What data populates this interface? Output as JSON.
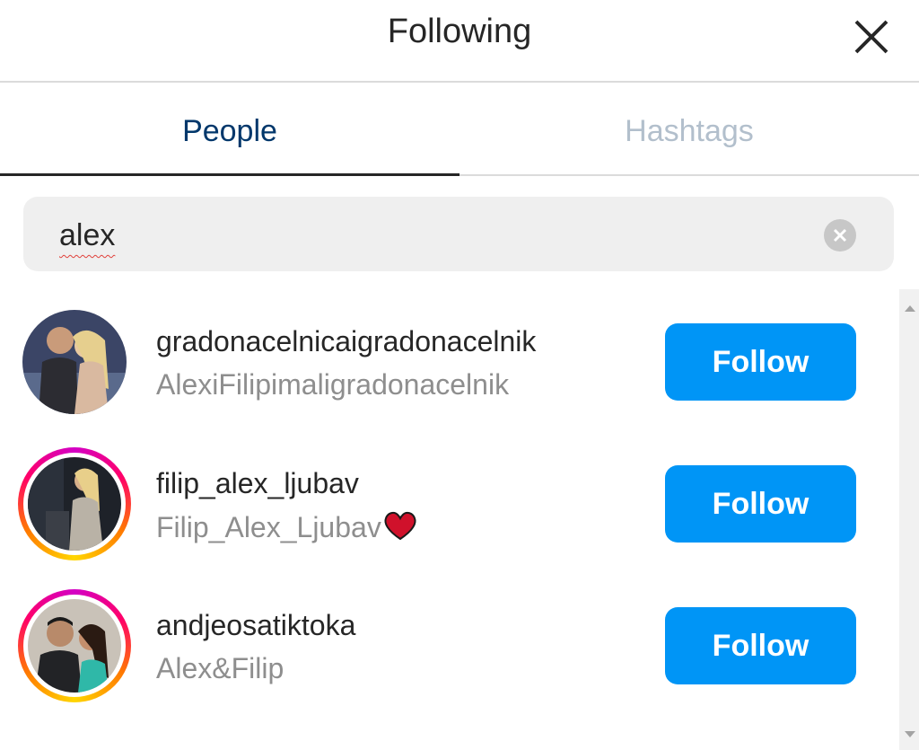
{
  "header": {
    "title": "Following"
  },
  "tabs": [
    {
      "label": "People",
      "active": true
    },
    {
      "label": "Hashtags",
      "active": false
    }
  ],
  "search": {
    "value": "alex"
  },
  "results": [
    {
      "username": "gradonacelnicaigradonacelnik",
      "full_name": "AlexiFilipimaligradonacelnik",
      "follow_label": "Follow",
      "has_story_ring": false
    },
    {
      "username": "filip_alex_ljubav",
      "full_name": "Filip_Alex_Ljubav",
      "full_name_emoji": "heart-icon",
      "follow_label": "Follow",
      "has_story_ring": true
    },
    {
      "username": "andjeosatiktoka",
      "full_name": "Alex&Filip",
      "follow_label": "Follow",
      "has_story_ring": true
    }
  ],
  "colors": {
    "follow_button": "#0095f6",
    "active_tab_text": "#00376b",
    "inactive_tab_text": "#b2bfcc"
  }
}
